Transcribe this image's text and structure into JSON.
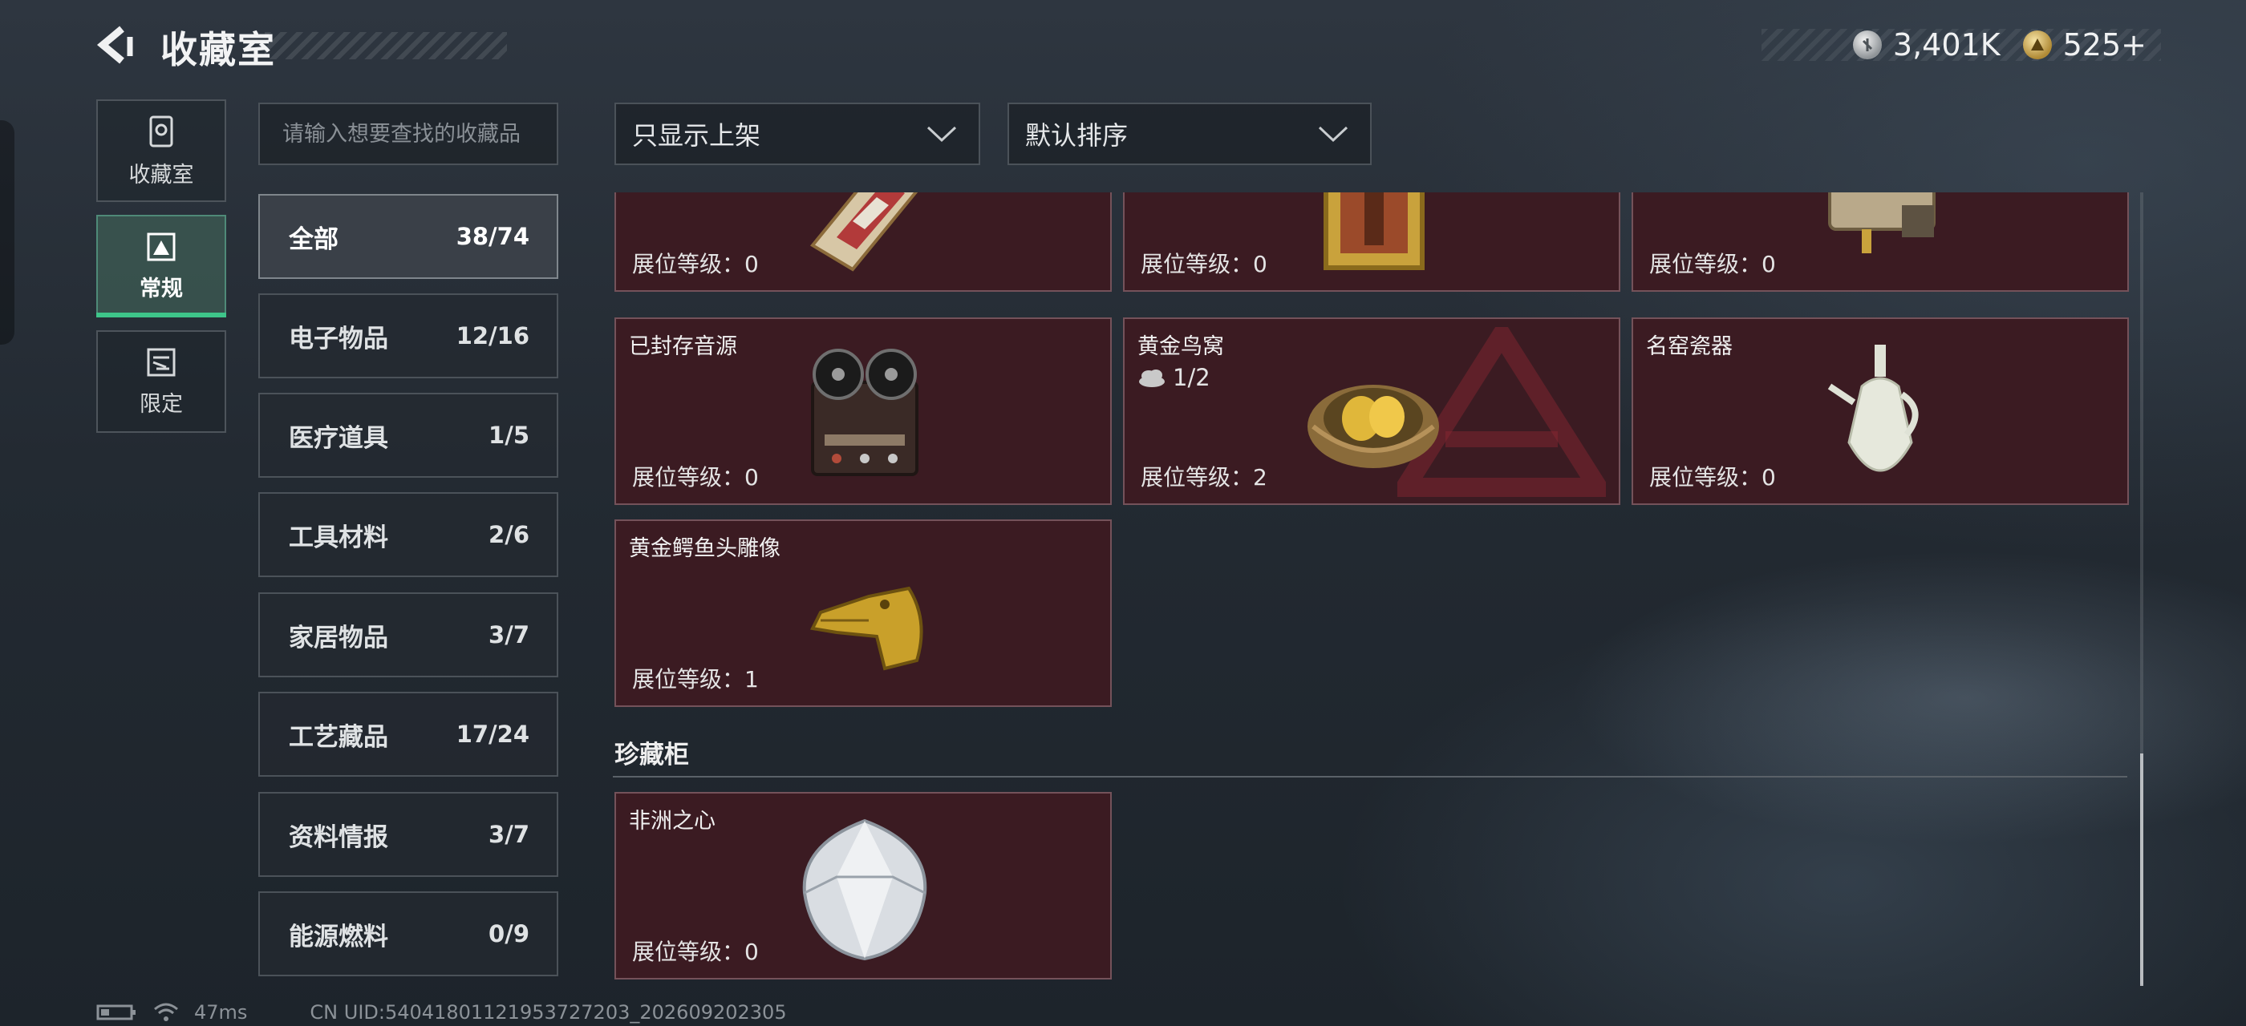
{
  "header": {
    "title": "收藏室",
    "currency": [
      {
        "icon": "silver-coin-icon",
        "value": "3,401K"
      },
      {
        "icon": "gold-coin-icon",
        "value": "525+"
      }
    ]
  },
  "side_tabs": [
    {
      "label": "收藏室",
      "icon": "collection-room-icon",
      "active": false
    },
    {
      "label": "常规",
      "icon": "regular-display-icon",
      "active": true
    },
    {
      "label": "限定",
      "icon": "limited-display-icon",
      "active": false
    }
  ],
  "search": {
    "placeholder": "请输入想要查找的收藏品",
    "value": ""
  },
  "categories": [
    {
      "name": "全部",
      "count": "38/74",
      "active": true
    },
    {
      "name": "电子物品",
      "count": "12/16"
    },
    {
      "name": "医疗道具",
      "count": "1/5"
    },
    {
      "name": "工具材料",
      "count": "2/6"
    },
    {
      "name": "家居物品",
      "count": "3/7"
    },
    {
      "name": "工艺藏品",
      "count": "17/24"
    },
    {
      "name": "资料情报",
      "count": "3/7"
    },
    {
      "name": "能源燃料",
      "count": "0/9"
    }
  ],
  "filters": {
    "display": "只显示上架",
    "sort": "默认排序"
  },
  "items": [
    {
      "name": "",
      "level_label": "展位等级：",
      "level": "0",
      "art": "jewel-box-art"
    },
    {
      "name": "",
      "level_label": "展位等级：",
      "level": "0",
      "art": "framed-painting-art"
    },
    {
      "name": "",
      "level_label": "展位等级：",
      "level": "0",
      "art": "brass-device-art"
    },
    {
      "name": "已封存音源",
      "level_label": "展位等级：",
      "level": "0",
      "art": "reel-tape-recorder-art"
    },
    {
      "name": "黄金鸟窝",
      "level_label": "展位等级：",
      "level": "2",
      "progress": "1/2",
      "art": "golden-nest-art"
    },
    {
      "name": "名窑瓷器",
      "level_label": "展位等级：",
      "level": "0",
      "art": "porcelain-vase-art"
    },
    {
      "name": "黄金鳄鱼头雕像",
      "level_label": "展位等级：",
      "level": "1",
      "art": "golden-crocodile-head-art"
    }
  ],
  "section": {
    "title": "珍藏柜",
    "items": [
      {
        "name": "非洲之心",
        "level_label": "展位等级：",
        "level": "0",
        "art": "diamond-art"
      }
    ]
  },
  "footer": {
    "ping": "47ms",
    "uid": "CN UID:5404180112195372​7203_202609202305"
  },
  "colors": {
    "card_bg": "#3b1b22",
    "card_border": "#74525a",
    "active_tab_accent": "#3ec58a"
  }
}
